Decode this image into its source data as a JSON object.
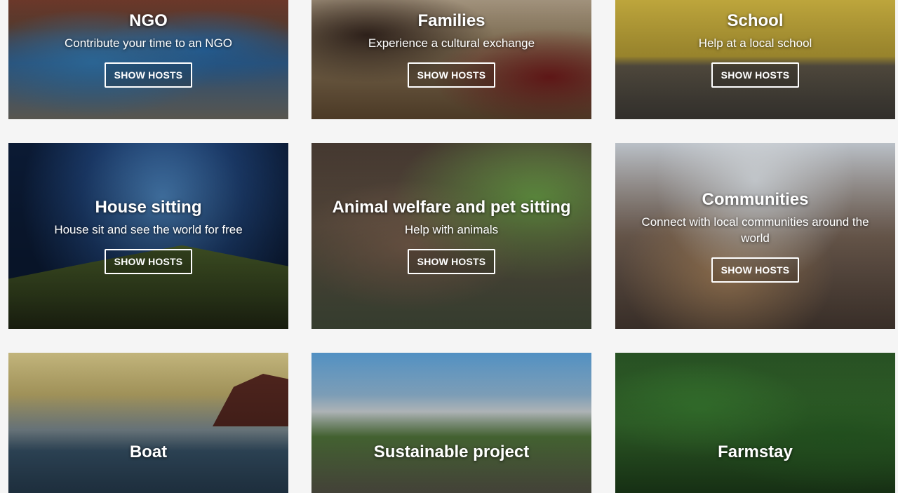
{
  "cards": [
    {
      "title": "NGO",
      "subtitle": "Contribute your time to an NGO",
      "button": "SHOW HOSTS"
    },
    {
      "title": "Families",
      "subtitle": "Experience a cultural exchange",
      "button": "SHOW HOSTS"
    },
    {
      "title": "School",
      "subtitle": "Help at a local school",
      "button": "SHOW HOSTS"
    },
    {
      "title": "House sitting",
      "subtitle": "House sit and see the world for free",
      "button": "SHOW HOSTS"
    },
    {
      "title": "Animal welfare and pet sitting",
      "subtitle": "Help with animals",
      "button": "SHOW HOSTS"
    },
    {
      "title": "Communities",
      "subtitle": "Connect with local communities around the world",
      "button": "SHOW HOSTS"
    },
    {
      "title": "Boat"
    },
    {
      "title": "Sustainable project"
    },
    {
      "title": "Farmstay"
    }
  ]
}
